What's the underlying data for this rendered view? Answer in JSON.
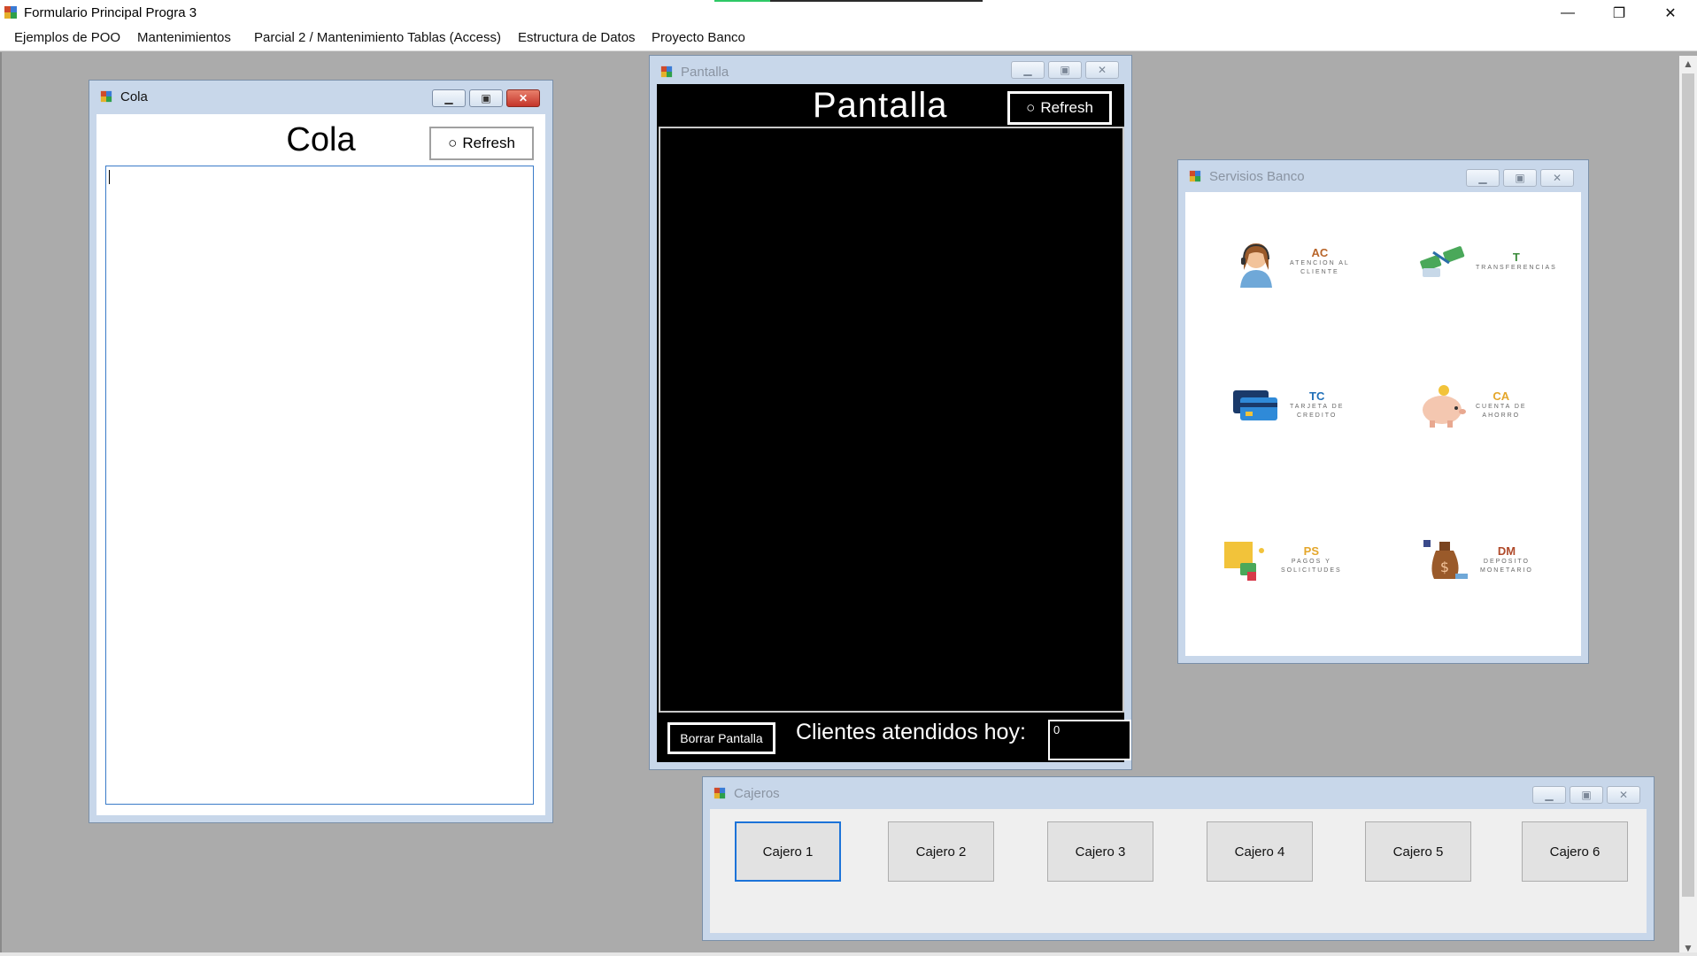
{
  "window": {
    "title": "Formulario Principal Progra 3",
    "minimize_glyph": "—",
    "restore_glyph": "❐",
    "close_glyph": "✕"
  },
  "menu": [
    {
      "label": "Ejemplos de POO"
    },
    {
      "label": "Mantenimientos"
    },
    {
      "label": "Parcial 2 / Mantenimiento Tablas (Access)"
    },
    {
      "label": "Estructura de Datos"
    },
    {
      "label": "Proyecto Banco"
    }
  ],
  "cola": {
    "title": "Cola",
    "heading": "Cola",
    "refresh_label": "Refresh"
  },
  "pantalla": {
    "title": "Pantalla",
    "heading": "Pantalla",
    "refresh_label": "Refresh",
    "borrar_label": "Borrar Pantalla",
    "clientes_label": "Clientes atendidos hoy:",
    "clientes_value": "0"
  },
  "servicios": {
    "title": "Servisios Banco",
    "items": [
      {
        "code": "AC",
        "desc1": "ATENCION AL",
        "desc2": "CLIENTE",
        "icon": "customer-service-icon",
        "color": "#b8652a"
      },
      {
        "code": "T",
        "desc1": "TRANSFERENCIAS",
        "desc2": "",
        "icon": "money-transfer-icon",
        "color": "#3a8a3a"
      },
      {
        "code": "TC",
        "desc1": "TARJETA DE",
        "desc2": "CREDITO",
        "icon": "credit-card-icon",
        "color": "#1f6fb8"
      },
      {
        "code": "CA",
        "desc1": "CUENTA DE",
        "desc2": "AHORRO",
        "icon": "piggy-bank-icon",
        "color": "#e4a62a"
      },
      {
        "code": "PS",
        "desc1": "PAGOS Y",
        "desc2": "SOLICITUDES",
        "icon": "payments-folder-icon",
        "color": "#e4a62a"
      },
      {
        "code": "DM",
        "desc1": "DEPOSITO",
        "desc2": "MONETARIO",
        "icon": "money-bag-icon",
        "color": "#b04a2a"
      }
    ]
  },
  "cajeros": {
    "title": "Cajeros",
    "buttons": [
      "Cajero 1",
      "Cajero 2",
      "Cajero 3",
      "Cajero 4",
      "Cajero 5",
      "Cajero 6"
    ]
  },
  "colors": {
    "mdi_background": "#ababab",
    "active_focus": "#1c73d8",
    "close_red": "#c4352a"
  }
}
